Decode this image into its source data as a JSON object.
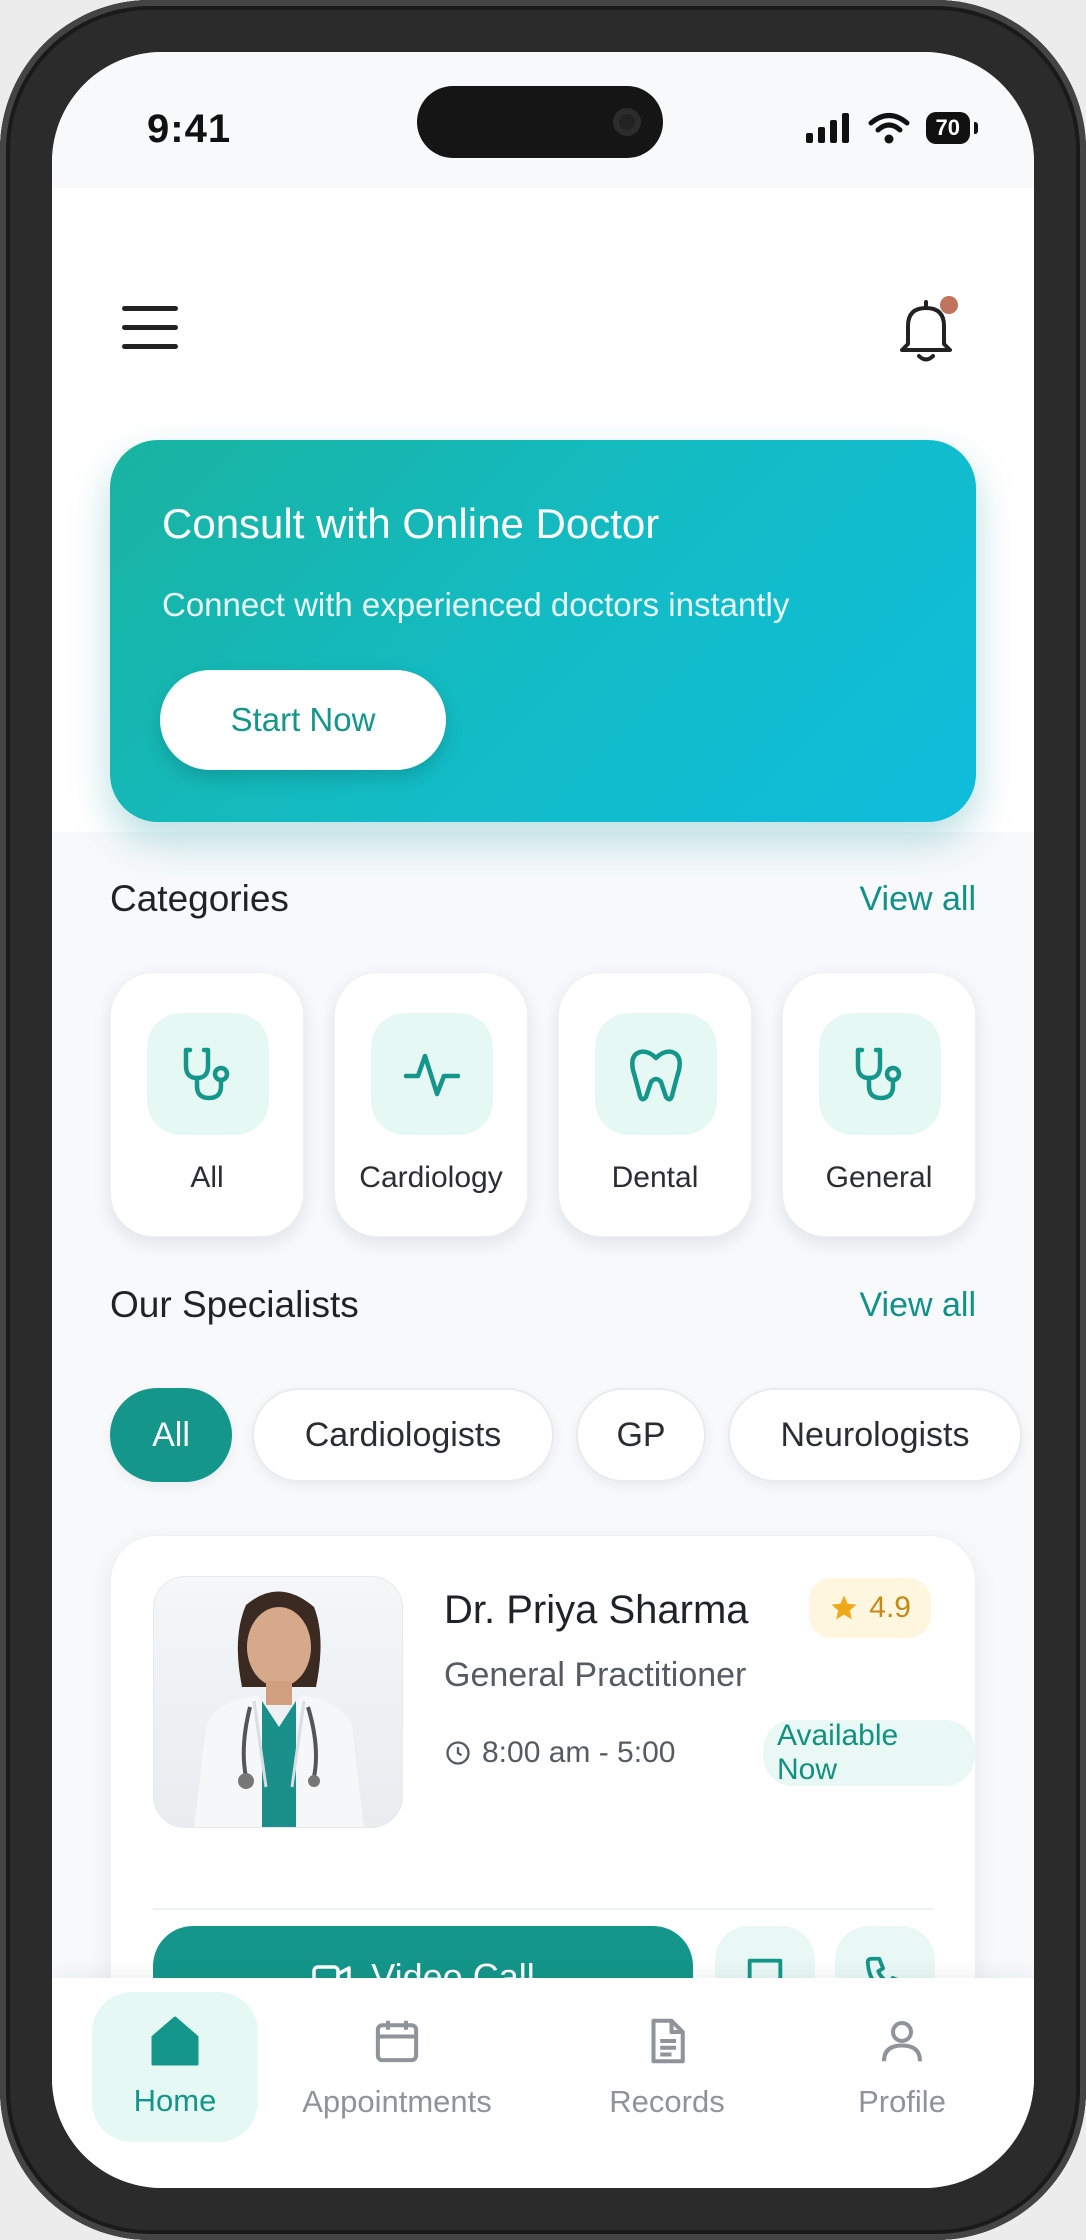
{
  "status_bar": {
    "time": "9:41",
    "battery": "70"
  },
  "header": {
    "menu_icon": "hamburger-menu-icon",
    "bell_icon": "bell-icon",
    "notification_dot_color": "#c0735d"
  },
  "hero": {
    "title": "Consult with Online Doctor",
    "subtitle": "Connect with experienced doctors instantly",
    "cta_label": "Start Now"
  },
  "categories": {
    "title": "Categories",
    "view_all": "View all",
    "items": [
      {
        "label": "All",
        "icon": "stethoscope-icon"
      },
      {
        "label": "Cardiology",
        "icon": "heartbeat-icon"
      },
      {
        "label": "Dental",
        "icon": "tooth-icon"
      },
      {
        "label": "General",
        "icon": "stethoscope-icon"
      }
    ]
  },
  "specialists": {
    "title": "Our Specialists",
    "view_all": "View all",
    "filters": [
      "All",
      "Cardiologists",
      "GP",
      "Neurologists"
    ],
    "active_filter": "All"
  },
  "doctor_card": {
    "name": "Dr. Priya Sharma",
    "rating": "4.9",
    "specialty": "General Practitioner",
    "hours": "8:00 am - 5:00",
    "availability": "Available Now",
    "video_call_label": "Video Call"
  },
  "tab_bar": {
    "tabs": [
      {
        "label": "Home",
        "icon": "home-icon"
      },
      {
        "label": "Appointments",
        "icon": "calendar-icon"
      },
      {
        "label": "Records",
        "icon": "document-icon"
      },
      {
        "label": "Profile",
        "icon": "user-icon"
      }
    ],
    "active": "Home"
  },
  "colors": {
    "accent": "#14968a",
    "hero_start": "#19b3a0",
    "hero_end": "#0fbddc",
    "rating": "#f0a818"
  }
}
